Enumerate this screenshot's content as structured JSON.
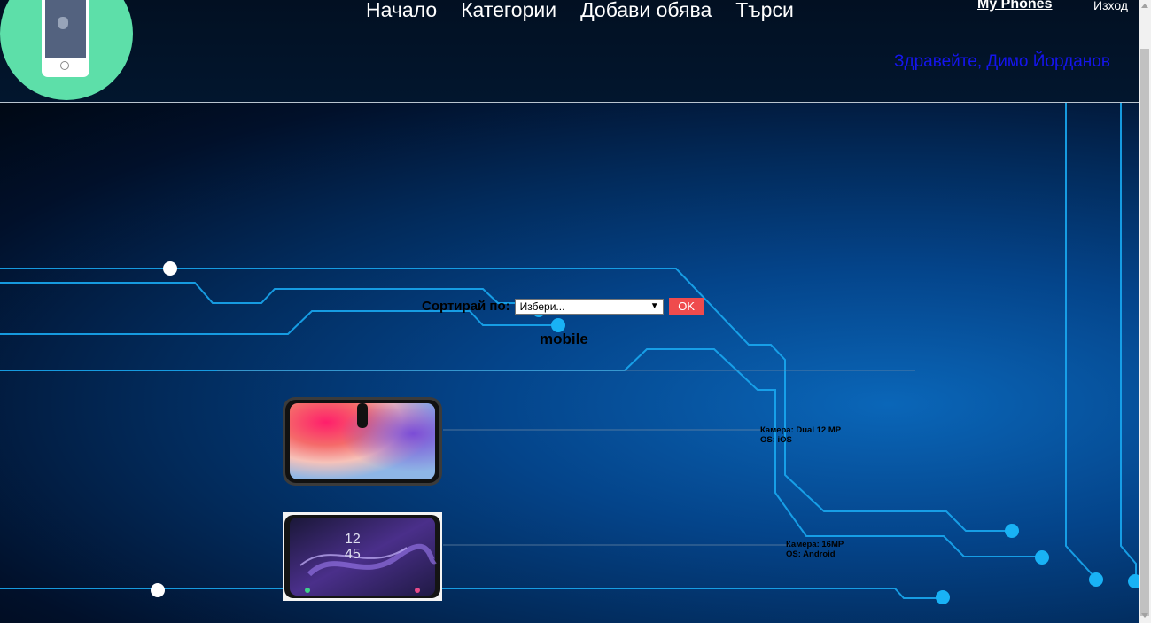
{
  "header": {
    "nav": [
      "Начало",
      "Категории",
      "Добави обява",
      "Търси"
    ],
    "brand": "My Phones",
    "logout": "Изход",
    "greeting": "Здравейте, Димо Йорданов"
  },
  "icons": {
    "logo": "phone-logo-icon"
  },
  "sort": {
    "label": "Сортирай по:",
    "selected": "Избери...",
    "button": "OK"
  },
  "category_title": "mobile",
  "listings": [
    {
      "image": "iphone-x-image",
      "camera": "Камера: Dual 12 MP",
      "os": "OS: iOS"
    },
    {
      "image": "galaxy-s9-image",
      "camera": "Камера: 16MP",
      "os": "OS: Android"
    }
  ],
  "colors": {
    "logo_bg": "#5ddfa9",
    "greeting": "#1515ee",
    "ok_button": "#ef4b4d",
    "circuit": "#19a8f0"
  }
}
